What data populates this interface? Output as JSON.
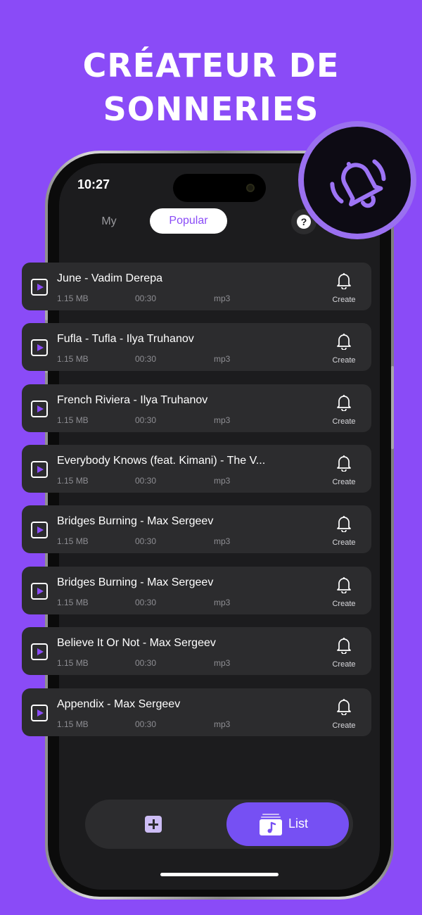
{
  "headline": {
    "line1": "CRÉATEUR DE",
    "line2": "SONNERIES"
  },
  "status": {
    "time": "10:27"
  },
  "tabs": {
    "my": "My",
    "popular": "Popular"
  },
  "header_icons": {
    "help": "?"
  },
  "create_label": "Create",
  "ringtones": [
    {
      "title": "June - Vadim Derepa",
      "size": "1.15 MB",
      "duration": "00:30",
      "format": "mp3"
    },
    {
      "title": "Fufla - Tufla - Ilya Truhanov",
      "size": "1.15 MB",
      "duration": "00:30",
      "format": "mp3"
    },
    {
      "title": "French Riviera  - Ilya Truhanov",
      "size": "1.15 MB",
      "duration": "00:30",
      "format": "mp3"
    },
    {
      "title": "Everybody Knows (feat. Kimani) - The V...",
      "size": "1.15 MB",
      "duration": "00:30",
      "format": "mp3"
    },
    {
      "title": "Bridges Burning - Max Sergeev",
      "size": "1.15 MB",
      "duration": "00:30",
      "format": "mp3"
    },
    {
      "title": "Bridges Burning - Max Sergeev",
      "size": "1.15 MB",
      "duration": "00:30",
      "format": "mp3"
    },
    {
      "title": "Believe It Or Not - Max Sergeev",
      "size": "1.15 MB",
      "duration": "00:30",
      "format": "mp3"
    },
    {
      "title": "Appendix - Max Sergeev",
      "size": "1.15 MB",
      "duration": "00:30",
      "format": "mp3"
    }
  ],
  "bottom_nav": {
    "list_label": "List"
  },
  "colors": {
    "background": "#8a4bf7",
    "accent": "#7650f3",
    "card": "#2c2c2e",
    "screen": "#1c1c1e"
  },
  "icons": [
    "bell-ringing-icon",
    "help-icon",
    "gear-icon",
    "play-icon",
    "bell-icon",
    "add-icon",
    "music-list-icon"
  ]
}
